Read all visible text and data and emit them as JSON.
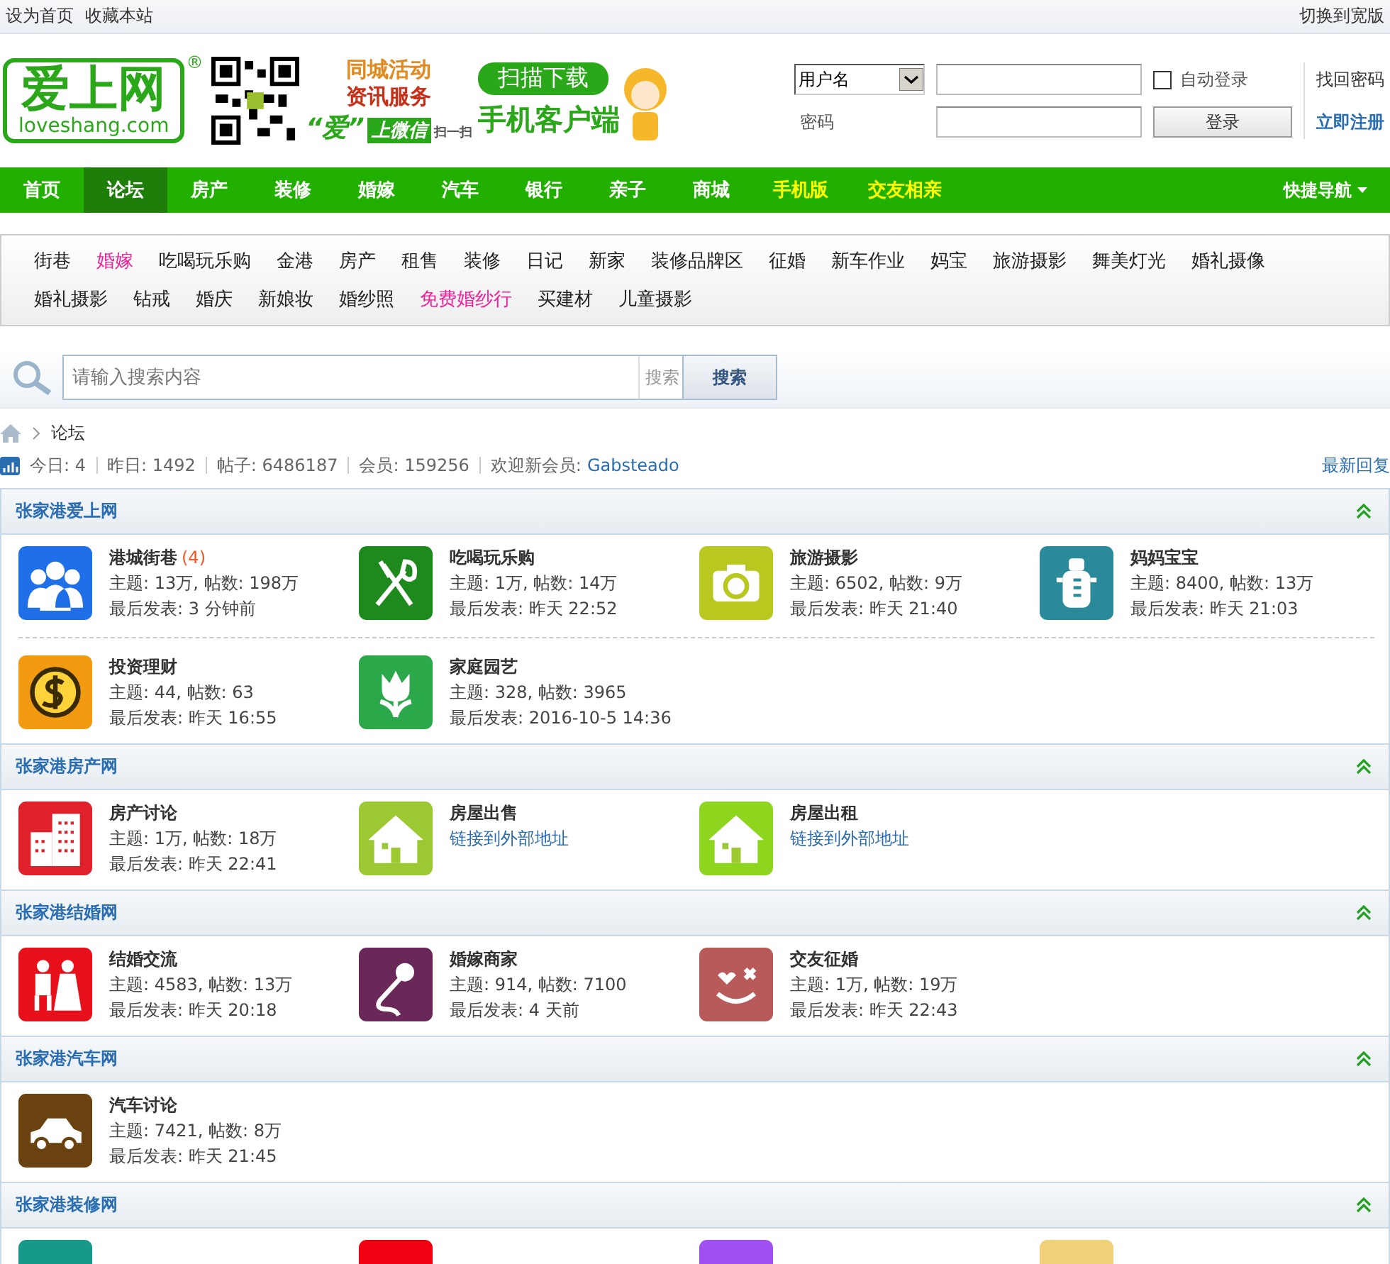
{
  "top_bar": {
    "links": [
      "设为首页",
      "收藏本站"
    ],
    "right_link": "切换到宽版"
  },
  "header": {
    "logo": {
      "name": "爱上网",
      "domain": "loveshang.com",
      "mark": "®"
    },
    "wechat_banner": {
      "line1": "同城活动",
      "line2": "资讯服务",
      "slogan_a": "“爱”",
      "slogan_b": "上微信",
      "scan": "扫一扫"
    },
    "app_banner": {
      "bubble": "扫描下载",
      "title": "手机客户端"
    }
  },
  "login": {
    "account_type": "用户名",
    "auto_login": {
      "label": "自动登录",
      "checked": false
    },
    "password_label": "密码",
    "submit": "登录",
    "find_password": "找回密码",
    "register": "立即注册"
  },
  "nav": {
    "items": [
      {
        "label": "首页",
        "selected": false,
        "highlight": false
      },
      {
        "label": "论坛",
        "selected": true,
        "highlight": false
      },
      {
        "label": "房产",
        "selected": false,
        "highlight": false
      },
      {
        "label": "装修",
        "selected": false,
        "highlight": false
      },
      {
        "label": "婚嫁",
        "selected": false,
        "highlight": false
      },
      {
        "label": "汽车",
        "selected": false,
        "highlight": false
      },
      {
        "label": "银行",
        "selected": false,
        "highlight": false
      },
      {
        "label": "亲子",
        "selected": false,
        "highlight": false
      },
      {
        "label": "商城",
        "selected": false,
        "highlight": false
      },
      {
        "label": "手机版",
        "selected": false,
        "highlight": true
      },
      {
        "label": "交友相亲",
        "selected": false,
        "highlight": true
      }
    ],
    "quick_nav": "快捷导航"
  },
  "sub_nav": [
    {
      "label": "街巷",
      "highlight": false
    },
    {
      "label": "婚嫁",
      "highlight": true
    },
    {
      "label": "吃喝玩乐购",
      "highlight": false
    },
    {
      "label": "金港",
      "highlight": false
    },
    {
      "label": "房产",
      "highlight": false
    },
    {
      "label": "租售",
      "highlight": false
    },
    {
      "label": "装修",
      "highlight": false
    },
    {
      "label": "日记",
      "highlight": false
    },
    {
      "label": "新家",
      "highlight": false
    },
    {
      "label": "装修品牌区",
      "highlight": false
    },
    {
      "label": "征婚",
      "highlight": false
    },
    {
      "label": "新车作业",
      "highlight": false
    },
    {
      "label": "妈宝",
      "highlight": false
    },
    {
      "label": "旅游摄影",
      "highlight": false
    },
    {
      "label": "舞美灯光",
      "highlight": false
    },
    {
      "label": "婚礼摄像",
      "highlight": false
    },
    {
      "label": "婚礼摄影",
      "highlight": false
    },
    {
      "label": "钻戒",
      "highlight": false
    },
    {
      "label": "婚庆",
      "highlight": false
    },
    {
      "label": "新娘妆",
      "highlight": false
    },
    {
      "label": "婚纱照",
      "highlight": false
    },
    {
      "label": "免费婚纱行",
      "highlight": true
    },
    {
      "label": "买建材",
      "highlight": false
    },
    {
      "label": "儿童摄影",
      "highlight": false
    }
  ],
  "search": {
    "placeholder": "请输入搜索内容",
    "type_label": "搜索",
    "button": "搜索"
  },
  "breadcrumb": {
    "current": "论坛"
  },
  "stats": {
    "items": [
      "今日: 4",
      "昨日: 1492",
      "帖子: 6486187",
      "会员: 159256"
    ],
    "welcome": "欢迎新会员:",
    "new_member": "Gabsteado",
    "latest_replies": "最新回复"
  },
  "sections": [
    {
      "title": "张家港爱上网",
      "rows": [
        [
          {
            "kind": "people",
            "color": "#1f6fe8",
            "title": "港城街巷",
            "new_count": "(4)",
            "stats": "主题: 13万, 帖数: 198万",
            "last_post": "最后发表: 3 分钟前"
          },
          {
            "kind": "cutlery",
            "color": "#1e8a1e",
            "title": "吃喝玩乐购",
            "stats": "主题: 1万, 帖数: 14万",
            "last_post": "最后发表: 昨天 22:52"
          },
          {
            "kind": "camera",
            "color": "#b8c81e",
            "title": "旅游摄影",
            "stats": "主题: 6502, 帖数: 9万",
            "last_post": "最后发表: 昨天 21:40"
          },
          {
            "kind": "bottle",
            "color": "#2a8a9a",
            "title": "妈妈宝宝",
            "stats": "主题: 8400, 帖数: 13万",
            "last_post": "最后发表: 昨天 21:03"
          }
        ],
        [
          {
            "kind": "dollar",
            "color": "#f29a10",
            "title": "投资理财",
            "stats": "主题: 44, 帖数: 63",
            "last_post": "最后发表: 昨天 16:55"
          },
          {
            "kind": "tulip",
            "color": "#2aa84a",
            "title": "家庭园艺",
            "stats": "主题: 328, 帖数: 3965",
            "last_post": "最后发表: 2016-10-5 14:36"
          }
        ]
      ]
    },
    {
      "title": "张家港房产网",
      "rows": [
        [
          {
            "kind": "building",
            "color": "#e0202a",
            "title": "房产讨论",
            "stats": "主题: 1万, 帖数: 18万",
            "last_post": "最后发表: 昨天 22:41"
          },
          {
            "kind": "house",
            "color": "#9cc832",
            "title": "房屋出售",
            "link": "链接到外部地址"
          },
          {
            "kind": "house",
            "color": "#8ed61e",
            "title": "房屋出租",
            "link": "链接到外部地址"
          }
        ]
      ]
    },
    {
      "title": "张家港结婚网",
      "rows": [
        [
          {
            "kind": "couple",
            "color": "#e8101a",
            "title": "结婚交流",
            "stats": "主题: 4583, 帖数: 13万",
            "last_post": "最后发表: 昨天 20:18"
          },
          {
            "kind": "mic",
            "color": "#6a2858",
            "title": "婚嫁商家",
            "stats": "主题: 914, 帖数: 7100",
            "last_post": "最后发表: 4 天前"
          },
          {
            "kind": "face",
            "color": "#b85a5a",
            "title": "交友征婚",
            "stats": "主题: 1万, 帖数: 19万",
            "last_post": "最后发表: 昨天 22:43"
          }
        ]
      ]
    },
    {
      "title": "张家港汽车网",
      "rows": [
        [
          {
            "kind": "car",
            "color": "#6a4210",
            "title": "汽车讨论",
            "stats": "主题: 7421, 帖数: 8万",
            "last_post": "最后发表: 昨天 21:45"
          }
        ]
      ]
    },
    {
      "title": "张家港装修网",
      "rows": [
        [
          {
            "kind": "plain",
            "color": "#17998a"
          },
          {
            "kind": "plain",
            "color": "#f00010"
          },
          {
            "kind": "plain",
            "color": "#a050f0"
          },
          {
            "kind": "plain",
            "color": "#f0d078"
          }
        ]
      ]
    }
  ]
}
